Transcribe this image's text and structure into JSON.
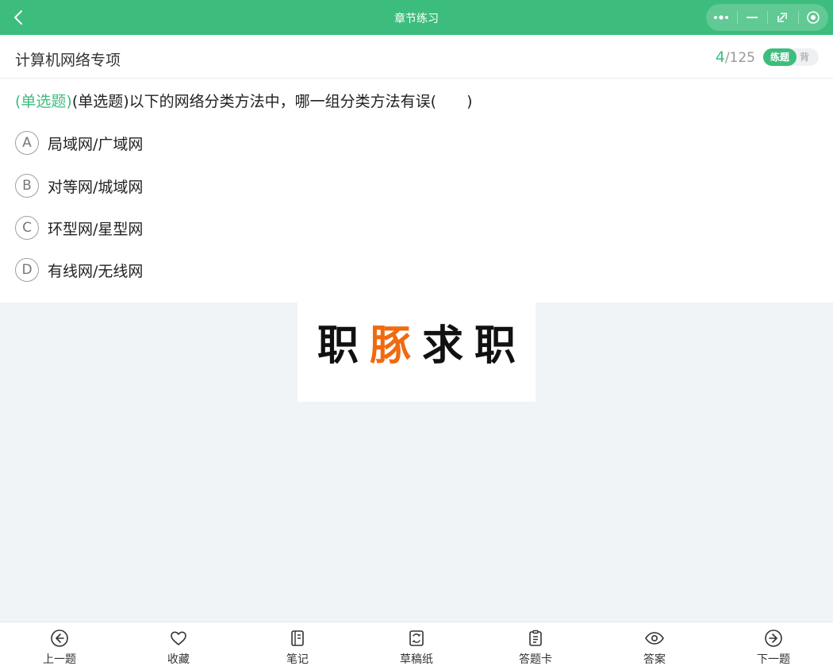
{
  "header": {
    "title": "章节练习"
  },
  "subheader": {
    "chapter": "计算机网络专项",
    "current": "4",
    "separator": "/",
    "total": "125",
    "mode_active": "练题",
    "mode_inactive": "背"
  },
  "question": {
    "type_label": "(单选题)",
    "text": "(单选题)以下的网络分类方法中，哪一组分类方法有误(　　)",
    "options": [
      {
        "letter": "A",
        "text": "局域网/广域网"
      },
      {
        "letter": "B",
        "text": "对等网/城域网"
      },
      {
        "letter": "C",
        "text": "环型网/星型网"
      },
      {
        "letter": "D",
        "text": "有线网/无线网"
      }
    ]
  },
  "ad": {
    "chars": [
      "职",
      "豚",
      "求",
      "职"
    ],
    "accent_color": "#f06a10"
  },
  "toolbar": [
    {
      "label": "上一题",
      "icon": "arrow-left-circle-icon"
    },
    {
      "label": "收藏",
      "icon": "heart-icon"
    },
    {
      "label": "笔记",
      "icon": "notebook-icon"
    },
    {
      "label": "草稿纸",
      "icon": "scratch-paper-icon"
    },
    {
      "label": "答题卡",
      "icon": "clipboard-icon"
    },
    {
      "label": "答案",
      "icon": "eye-icon"
    },
    {
      "label": "下一题",
      "icon": "arrow-right-circle-icon"
    }
  ],
  "colors": {
    "brand": "#3dbd7d",
    "accent": "#f06a10",
    "background": "#f0f4f7"
  }
}
